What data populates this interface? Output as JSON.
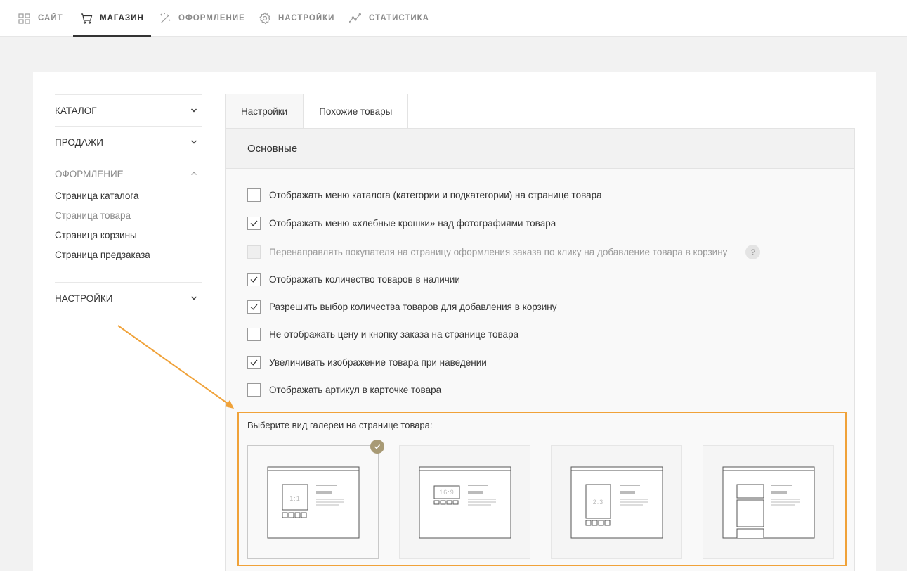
{
  "topnav": {
    "items": [
      {
        "label": "Сайт",
        "icon": "grid-icon"
      },
      {
        "label": "Магазин",
        "icon": "cart-icon"
      },
      {
        "label": "Оформление",
        "icon": "magic-wand-icon"
      },
      {
        "label": "Настройки",
        "icon": "gear-icon"
      },
      {
        "label": "Статистика",
        "icon": "line-chart-icon"
      }
    ],
    "active_index": 1
  },
  "sidebar": {
    "groups": [
      {
        "label": "Каталог"
      },
      {
        "label": "Продажи"
      },
      {
        "label": "Оформление",
        "expanded": true,
        "items": [
          "Страница каталога",
          "Страница товара",
          "Страница корзины",
          "Страница предзаказа"
        ],
        "current_index": 1
      },
      {
        "label": "Настройки"
      }
    ]
  },
  "tabs": [
    {
      "label": "Настройки",
      "active": true
    },
    {
      "label": "Похожие товары",
      "active": false
    }
  ],
  "section": {
    "title": "Основные",
    "options": [
      {
        "label": "Отображать меню каталога (категории и подкатегории) на странице товара",
        "checked": false,
        "disabled": false
      },
      {
        "label": "Отображать меню «хлебные крошки» над фотографиями товара",
        "checked": true,
        "disabled": false
      },
      {
        "label": "Перенаправлять покупателя на страницу оформления заказа по клику на добавление товара в корзину",
        "checked": false,
        "disabled": true,
        "help": "?"
      },
      {
        "label": "Отображать количество товаров в наличии",
        "checked": true,
        "disabled": false
      },
      {
        "label": "Разрешить выбор количества товаров для добавления в корзину",
        "checked": true,
        "disabled": false
      },
      {
        "label": "Не отображать цену и кнопку заказа на странице товара",
        "checked": false,
        "disabled": false
      },
      {
        "label": "Увеличивать изображение товара при наведении",
        "checked": true,
        "disabled": false
      },
      {
        "label": "Отображать артикул в карточке товара",
        "checked": false,
        "disabled": false
      }
    ]
  },
  "gallery": {
    "label": "Выберите вид галереи на странице товара:",
    "options": [
      {
        "ratio": "1:1",
        "selected": true
      },
      {
        "ratio": "16:9",
        "selected": false
      },
      {
        "ratio": "2:3",
        "selected": false
      },
      {
        "ratio": "",
        "selected": false
      }
    ]
  },
  "colors": {
    "highlight": "#f0a239",
    "selected_badge": "#a89a75",
    "text": "#333333",
    "muted": "#8a8a8a"
  }
}
